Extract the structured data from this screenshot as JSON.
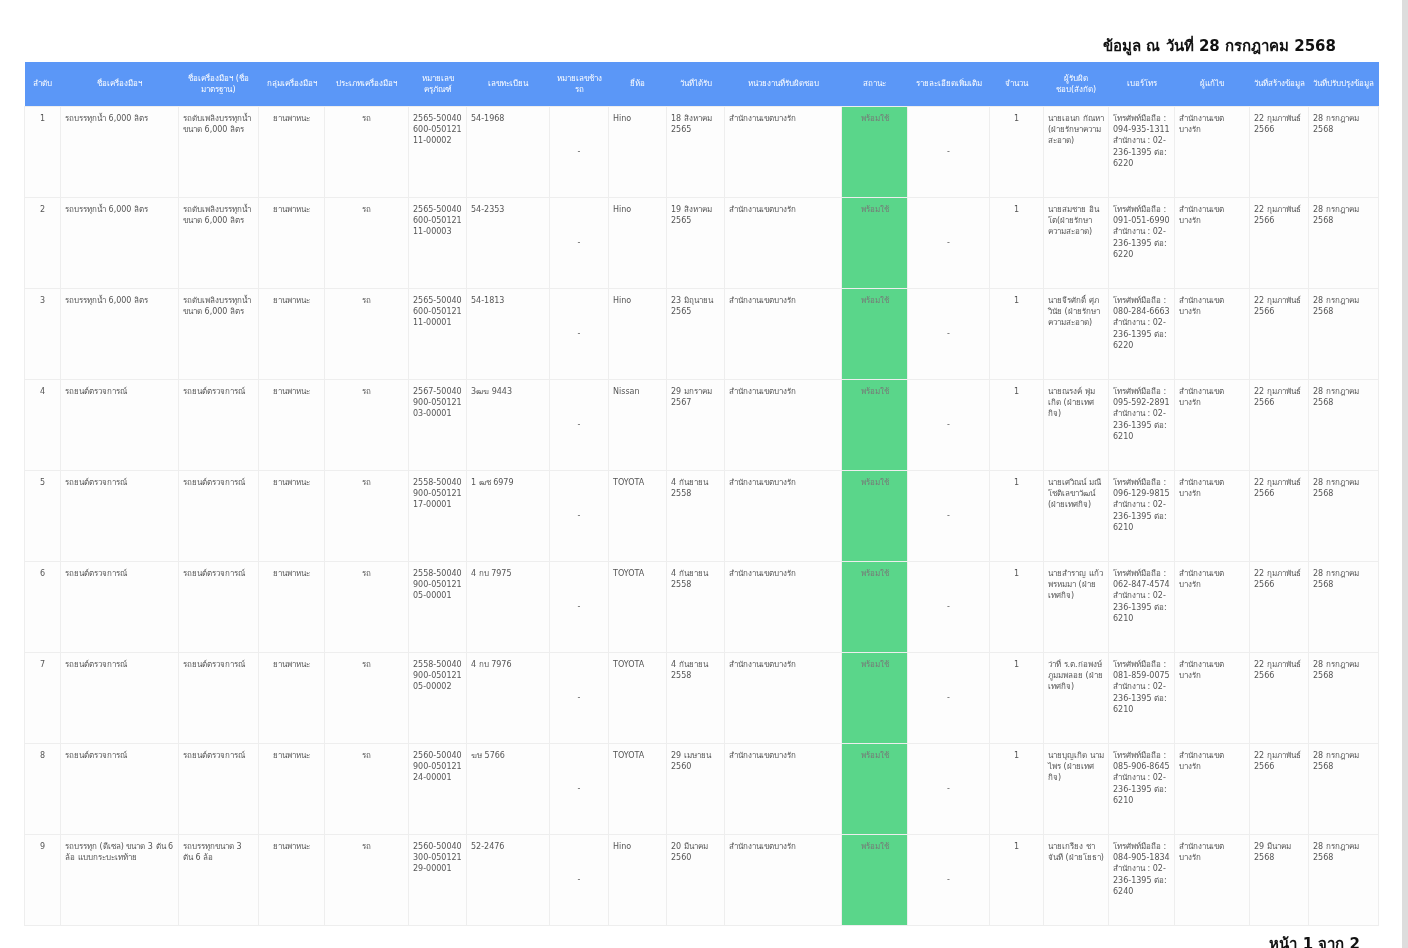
{
  "title": "ข้อมูล ณ วันที่ 28 กรกฎาคม 2568",
  "table": {
    "columns": [
      "ลำดับ",
      "ชื่อเครื่องมือฯ",
      "ชื่อเครื่องมือฯ (ชื่อมาตรฐาน)",
      "กลุ่มเครื่องมือฯ",
      "ประเภทเครื่องมือฯ",
      "หมายเลขครุภัณฑ์",
      "เลขทะเบียน",
      "หมายเลขช้างรถ",
      "ยี่ห้อ",
      "วันที่ได้รับ",
      "หน่วยงานที่รับผิดชอบ",
      "สถานะ",
      "รายละเอียดเพิ่มเติม",
      "จำนวน",
      "ผู้รับผิดชอบ(สังกัด)",
      "เบอร์โทร",
      "ผู้แก้ไข",
      "วันที่สร้างข้อมูล",
      "วันที่ปรับปรุงข้อมูล"
    ],
    "rows": [
      {
        "cells": [
          "1",
          "รถบรรทุกน้ำ 6,000 ลิตร",
          "รถดับเพลิงบรรทุกน้ำขนาด 6,000 ลิตร",
          "ยานพาหนะ",
          "รถ",
          "2565-50040600-05012111-00002",
          "54-1968",
          "-",
          "Hino",
          "18 สิงหาคม 2565",
          "สำนักงานเขตบางรัก"
        ],
        "status": {
          "text": "พร้อมใช้",
          "color": "#5ad68a"
        },
        "rest": [
          "-",
          "1",
          "นายเอนก กัณหา (ฝ่ายรักษาความสะอาด)",
          "โทรศัพท์มือถือ : 094-935-1311 สำนักงาน : 02-236-1395 ต่อ: 6220",
          "สำนักงานเขตบางรัก",
          "22 กุมภาพันธ์ 2566",
          "28 กรกฎาคม 2568"
        ]
      },
      {
        "cells": [
          "2",
          "รถบรรทุกน้ำ 6,000 ลิตร",
          "รถดับเพลิงบรรทุกน้ำขนาด 6,000 ลิตร",
          "ยานพาหนะ",
          "รถ",
          "2565-50040600-05012111-00003",
          "54-2353",
          "-",
          "Hino",
          "19 สิงหาคม 2565",
          "สำนักงานเขตบางรัก"
        ],
        "status": {
          "text": "พร้อมใช้",
          "color": "#5ad68a"
        },
        "rest": [
          "-",
          "1",
          "นายสมชาย อินโต(ฝ่ายรักษาความสะอาด)",
          "โทรศัพท์มือถือ : 091-051-6990 สำนักงาน : 02-236-1395 ต่อ: 6220",
          "สำนักงานเขตบางรัก",
          "22 กุมภาพันธ์ 2566",
          "28 กรกฎาคม 2568"
        ]
      },
      {
        "cells": [
          "3",
          "รถบรรทุกน้ำ 6,000 ลิตร",
          "รถดับเพลิงบรรทุกน้ำขนาด 6,000 ลิตร",
          "ยานพาหนะ",
          "รถ",
          "2565-50040600-05012111-00001",
          "54-1813",
          "-",
          "Hino",
          "23 มิถุนายน 2565",
          "สำนักงานเขตบางรัก"
        ],
        "status": {
          "text": "พร้อมใช้",
          "color": "#5ad68a"
        },
        "rest": [
          "-",
          "1",
          "นายจีรศักดิ์ ศุภวินัย (ฝ่ายรักษาความสะอาด)",
          "โทรศัพท์มือถือ : 080-284-6663 สำนักงาน : 02-236-1395 ต่อ: 6220",
          "สำนักงานเขตบางรัก",
          "22 กุมภาพันธ์ 2566",
          "28 กรกฎาคม 2568"
        ]
      },
      {
        "cells": [
          "4",
          "รถยนต์ตรวจการณ์",
          "รถยนต์ตรวจการณ์",
          "ยานพาหนะ",
          "รถ",
          "2567-50040900-05012103-00001",
          "3ฒฆ 9443",
          "-",
          "Nissan",
          "29 มกราคม 2567",
          "สำนักงานเขตบางรัก"
        ],
        "status": {
          "text": "พร้อมใช้",
          "color": "#5ad68a"
        },
        "rest": [
          "-",
          "1",
          "นายณรงค์ พุ่มเกิด (ฝ่ายเทศกิจ)",
          "โทรศัพท์มือถือ : 095-592-2891 สำนักงาน : 02-236-1395 ต่อ: 6210",
          "สำนักงานเขตบางรัก",
          "22 กุมภาพันธ์ 2566",
          "28 กรกฎาคม 2568"
        ]
      },
      {
        "cells": [
          "5",
          "รถยนต์ตรวจการณ์",
          "รถยนต์ตรวจการณ์",
          "ยานพาหนะ",
          "รถ",
          "2558-50040900-05012117-00001",
          "1 ฒช 6979",
          "-",
          "TOYOTA",
          "4 กันยายน 2558",
          "สำนักงานเขตบางรัก"
        ],
        "status": {
          "text": "พร้อมใช้",
          "color": "#5ad68a"
        },
        "rest": [
          "-",
          "1",
          "นายเศวิณน์ มณีโชติเลขาวัฒน์ (ฝ่ายเทศกิจ)",
          "โทรศัพท์มือถือ : 096-129-9815 สำนักงาน : 02-236-1395 ต่อ: 6210",
          "สำนักงานเขตบางรัก",
          "22 กุมภาพันธ์ 2566",
          "28 กรกฎาคม 2568"
        ]
      },
      {
        "cells": [
          "6",
          "รถยนต์ตรวจการณ์",
          "รถยนต์ตรวจการณ์",
          "ยานพาหนะ",
          "รถ",
          "2558-50040900-05012105-00001",
          "4 กบ 7975",
          "-",
          "TOYOTA",
          "4 กันยายน 2558",
          "สำนักงานเขตบางรัก"
        ],
        "status": {
          "text": "พร้อมใช้",
          "color": "#5ad68a"
        },
        "rest": [
          "-",
          "1",
          "นายสำราญ แก้วพรหมมา (ฝ่ายเทศกิจ)",
          "โทรศัพท์มือถือ : 062-847-4574 สำนักงาน : 02-236-1395 ต่อ: 6210",
          "สำนักงานเขตบางรัก",
          "22 กุมภาพันธ์ 2566",
          "28 กรกฎาคม 2568"
        ]
      },
      {
        "cells": [
          "7",
          "รถยนต์ตรวจการณ์",
          "รถยนต์ตรวจการณ์",
          "ยานพาหนะ",
          "รถ",
          "2558-50040900-05012105-00002",
          "4 กบ 7976",
          "-",
          "TOYOTA",
          "4 กันยายน 2558",
          "สำนักงานเขตบางรัก"
        ],
        "status": {
          "text": "พร้อมใช้",
          "color": "#5ad68a"
        },
        "rest": [
          "-",
          "1",
          "ว่าที่ ร.ต.ก่อพงษ์ ภูมมพลอย (ฝ่ายเทศกิจ)",
          "โทรศัพท์มือถือ : 081-859-0075 สำนักงาน : 02-236-1395 ต่อ: 6210",
          "สำนักงานเขตบางรัก",
          "22 กุมภาพันธ์ 2566",
          "28 กรกฎาคม 2568"
        ]
      },
      {
        "cells": [
          "8",
          "รถยนต์ตรวจการณ์",
          "รถยนต์ตรวจการณ์",
          "ยานพาหนะ",
          "รถ",
          "2560-50040900-05012124-00001",
          "ฆษ 5766",
          "-",
          "TOYOTA",
          "29 เมษายน 2560",
          "สำนักงานเขตบางรัก"
        ],
        "status": {
          "text": "พร้อมใช้",
          "color": "#5ad68a"
        },
        "rest": [
          "-",
          "1",
          "นายบุญเกิด นามไพร (ฝ่ายเทศกิจ)",
          "โทรศัพท์มือถือ : 085-906-8645 สำนักงาน : 02-236-1395 ต่อ: 6210",
          "สำนักงานเขตบางรัก",
          "22 กุมภาพันธ์ 2566",
          "28 กรกฎาคม 2568"
        ]
      },
      {
        "cells": [
          "9",
          "รถบรรทุก (ดีเซล) ขนาด 3 ตัน 6 ล้อ แบบกระบะเทท้าย",
          "รถบรรทุกขนาด 3 ตัน 6 ล้อ",
          "ยานพาหนะ",
          "รถ",
          "2560-50040300-05012129-00001",
          "52-2476",
          "-",
          "Hino",
          "20 มีนาคม 2560",
          "สำนักงานเขตบางรัก"
        ],
        "status": {
          "text": "พร้อมใช้",
          "color": "#5ad68a"
        },
        "rest": [
          "-",
          "1",
          "นายเกรียง ชาจันที (ฝ่ายโยธา)",
          "โทรศัพท์มือถือ : 084-905-1834 สำนักงาน : 02-236-1395 ต่อ: 6240",
          "สำนักงานเขตบางรัก",
          "29 มีนาคม 2568",
          "28 กรกฎาคม 2568"
        ]
      }
    ]
  },
  "footer": "หน้า 1 จาก 2"
}
